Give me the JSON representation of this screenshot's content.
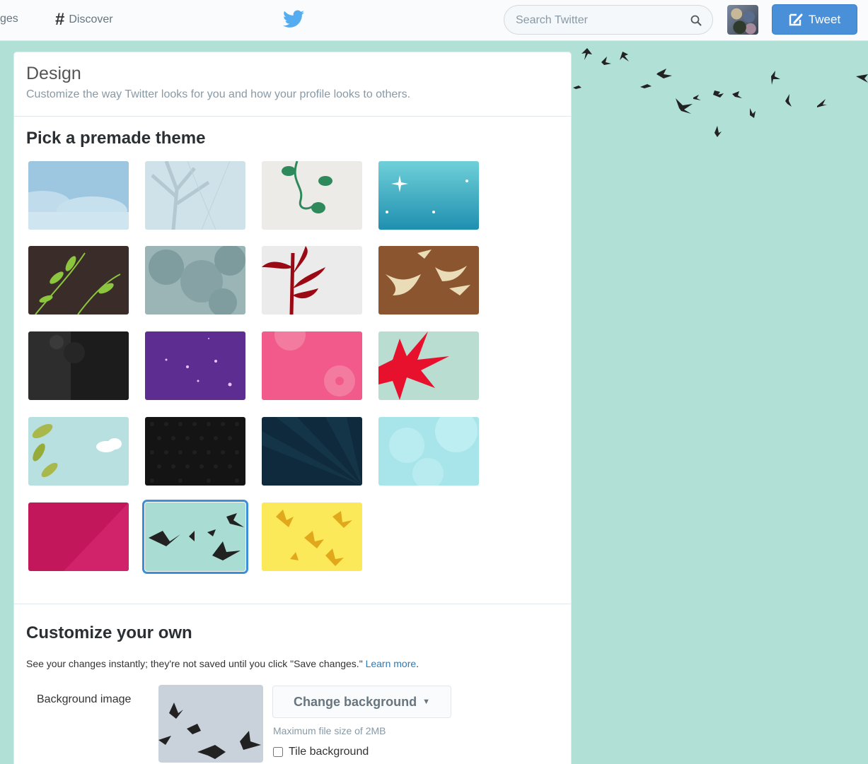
{
  "topbar": {
    "messages_label": "ges",
    "discover_label": "Discover",
    "search_placeholder": "Search Twitter",
    "tweet_label": "Tweet"
  },
  "panel": {
    "title": "Design",
    "subtitle": "Customize the way Twitter looks for you and how your profile looks to others."
  },
  "premade": {
    "title": "Pick a premade theme",
    "selected_index": 17
  },
  "customize": {
    "title": "Customize your own",
    "description": "See your changes instantly; they're not saved until you click \"Save changes.\"",
    "learn_more": "Learn more",
    "background_label": "Background image",
    "change_background_label": "Change background",
    "max_file_size": "Maximum file size of 2MB",
    "tile_background_label": "Tile background",
    "tile_checked": false
  },
  "colors": {
    "page_bg": "#b1e0d7",
    "tweet_button": "#4a90d9",
    "link": "#2b7bb9",
    "selected_outline": "#3d8ed8"
  }
}
